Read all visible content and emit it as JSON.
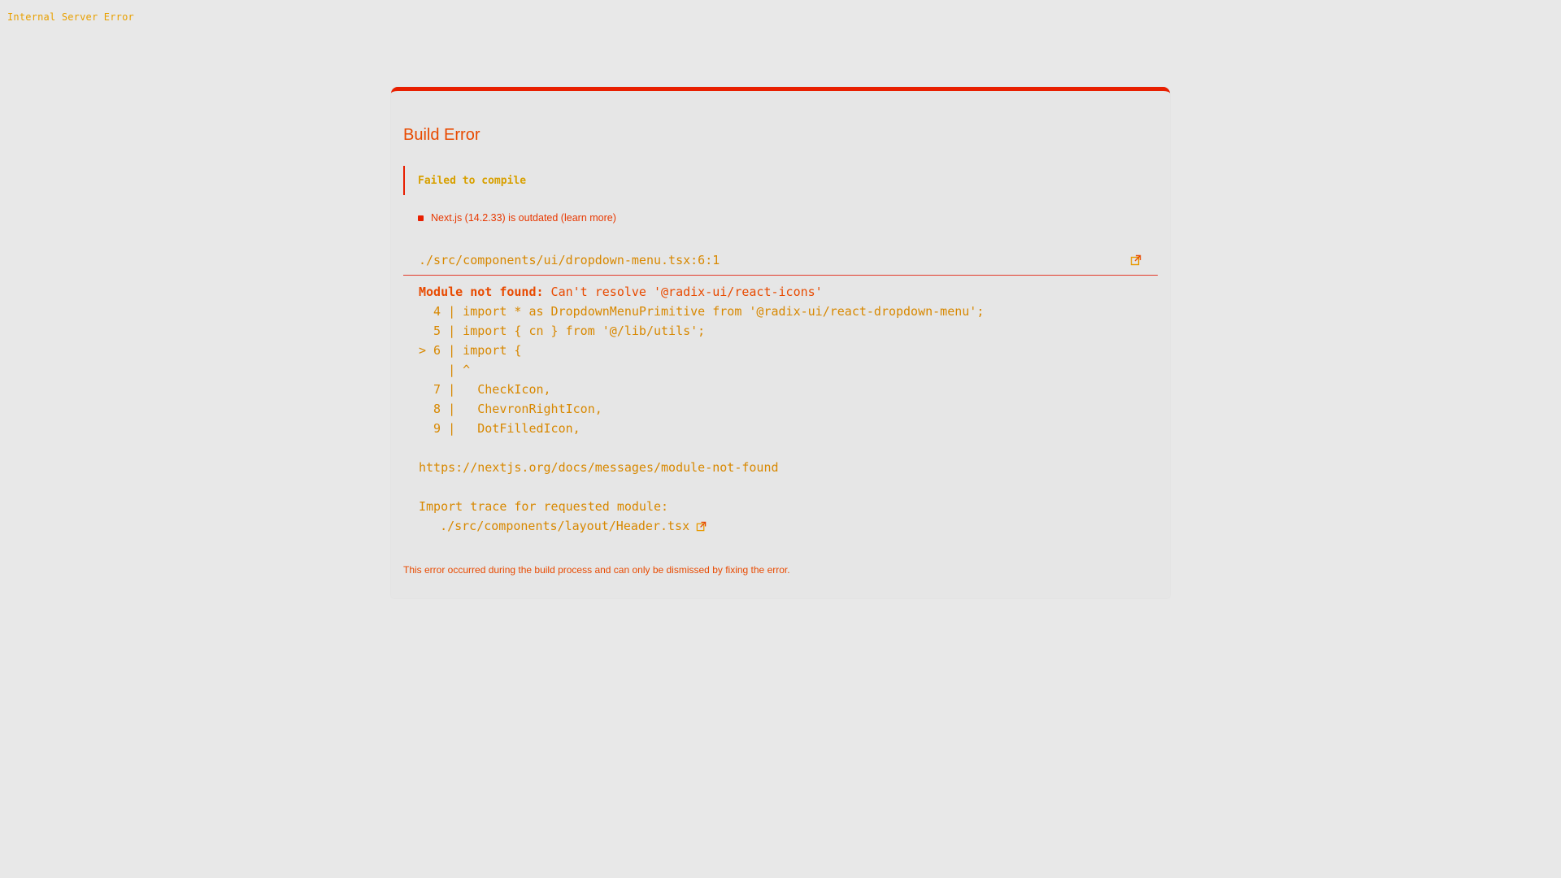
{
  "page": {
    "label": "Internal Server Error"
  },
  "dialog": {
    "title": "Build Error",
    "status": "Failed to compile",
    "version_notice": "Next.js (14.2.33) is outdated (learn more)",
    "file_path": "./src/components/ui/dropdown-menu.tsx:6:1",
    "error_label": "Module not found:",
    "error_message": " Can't resolve '@radix-ui/react-icons'",
    "code_lines": [
      "  4 | import * as DropdownMenuPrimitive from '@radix-ui/react-dropdown-menu';",
      "  5 | import { cn } from '@/lib/utils';",
      "> 6 | import {",
      "    | ^",
      "  7 |   CheckIcon,",
      "  8 |   ChevronRightIcon,",
      "  9 |   DotFilledIcon,"
    ],
    "docs_link": "https://nextjs.org/docs/messages/module-not-found",
    "trace_heading": "Import trace for requested module:",
    "trace_file": "./src/components/layout/Header.tsx",
    "footer": "This error occurred during the build process and can only be dismissed by fixing the error."
  },
  "colors": {
    "accent_red": "#e81f00",
    "text_orange": "#e84a00",
    "code_amber": "#d88800",
    "background": "#e8e8e8"
  },
  "icons": {
    "open_in_editor": "external-link-icon",
    "trace_open": "external-link-icon",
    "version_indicator": "status-dot-icon"
  }
}
